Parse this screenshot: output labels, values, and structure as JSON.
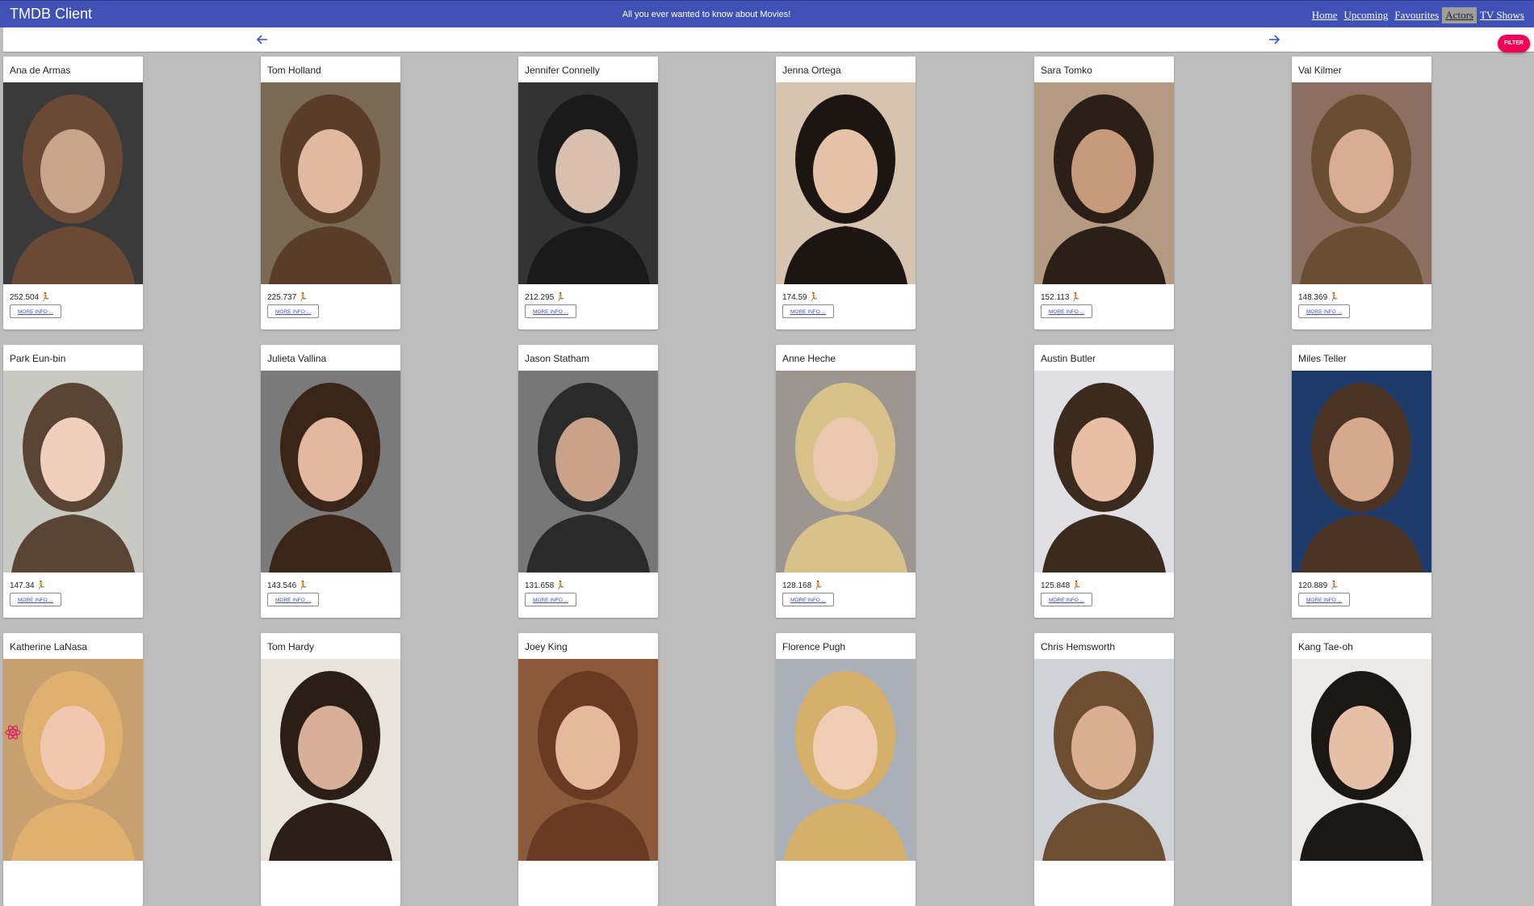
{
  "header": {
    "title": "TMDB Client",
    "tagline": "All you ever wanted to know about Movies!",
    "nav": [
      "Home",
      "Upcoming",
      "Favourites",
      "Actors",
      "TV Shows"
    ],
    "active_nav": "Actors"
  },
  "toolbar": {
    "back_icon": "arrow-left-icon",
    "forward_icon": "arrow-right-icon",
    "filter_label": "FILTER"
  },
  "accent_colors": {
    "appbar": "#3f51b5",
    "filter": "#f50057",
    "background": "#bdbdbd"
  },
  "actors": [
    {
      "name": "Ana de Armas",
      "popularity": "252.504",
      "more": "MORE INFO ..."
    },
    {
      "name": "Tom Holland",
      "popularity": "225.737",
      "more": "MORE INFO ..."
    },
    {
      "name": "Jennifer Connelly",
      "popularity": "212.295",
      "more": "MORE INFO ..."
    },
    {
      "name": "Jenna Ortega",
      "popularity": "174.59",
      "more": "MORE INFO ..."
    },
    {
      "name": "Sara Tomko",
      "popularity": "152.113",
      "more": "MORE INFO ..."
    },
    {
      "name": "Val Kilmer",
      "popularity": "148.369",
      "more": "MORE INFO ..."
    },
    {
      "name": "Park Eun-bin",
      "popularity": "147.34",
      "more": "MORE INFO ..."
    },
    {
      "name": "Julieta Vallina",
      "popularity": "143.546",
      "more": "MORE INFO ..."
    },
    {
      "name": "Jason Statham",
      "popularity": "131.658",
      "more": "MORE INFO ..."
    },
    {
      "name": "Anne Heche",
      "popularity": "128.168",
      "more": "MORE INFO ..."
    },
    {
      "name": "Austin Butler",
      "popularity": "125.848",
      "more": "MORE INFO ..."
    },
    {
      "name": "Miles Teller",
      "popularity": "120.889",
      "more": "MORE INFO ..."
    },
    {
      "name": "Katherine LaNasa",
      "popularity": "",
      "more": ""
    },
    {
      "name": "Tom Hardy",
      "popularity": "",
      "more": ""
    },
    {
      "name": "Joey King",
      "popularity": "",
      "more": ""
    },
    {
      "name": "Florence Pugh",
      "popularity": "",
      "more": ""
    },
    {
      "name": "Chris Hemsworth",
      "popularity": "",
      "more": ""
    },
    {
      "name": "Kang Tae-oh",
      "popularity": "",
      "more": ""
    }
  ]
}
